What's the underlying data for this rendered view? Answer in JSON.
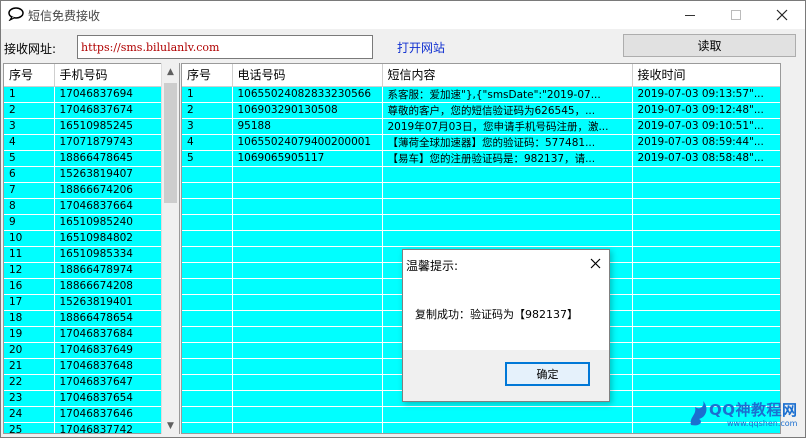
{
  "window": {
    "title": "短信免费接收"
  },
  "toolbar": {
    "url_label": "接收网址:",
    "url_value": "https://sms.bilulanlv.com",
    "open_link": "打开网站",
    "read_button": "读取"
  },
  "numbers": {
    "headers": [
      "序号",
      "手机号码"
    ],
    "rows": [
      [
        "1",
        "17046837694"
      ],
      [
        "2",
        "17046837674"
      ],
      [
        "3",
        "16510985245"
      ],
      [
        "4",
        "17071879743"
      ],
      [
        "5",
        "18866478645"
      ],
      [
        "6",
        "15263819407"
      ],
      [
        "7",
        "18866674206"
      ],
      [
        "8",
        "17046837664"
      ],
      [
        "9",
        "16510985240"
      ],
      [
        "10",
        "16510984802"
      ],
      [
        "11",
        "16510985334"
      ],
      [
        "12",
        "18866478974"
      ],
      [
        "16",
        "18866674208"
      ],
      [
        "17",
        "15263819401"
      ],
      [
        "18",
        "18866478654"
      ],
      [
        "19",
        "17046837684"
      ],
      [
        "20",
        "17046837649"
      ],
      [
        "21",
        "17046837648"
      ],
      [
        "22",
        "17046837647"
      ],
      [
        "23",
        "17046837654"
      ],
      [
        "24",
        "17046837646"
      ],
      [
        "25",
        "17046837742"
      ]
    ]
  },
  "messages": {
    "headers": [
      "序号",
      "电话号码",
      "短信内容",
      "接收时间"
    ],
    "rows": [
      [
        "1",
        "10655024082833230566",
        "系客服：爱加速\"},{\"smsDate\":\"2019-07...",
        "2019-07-03 09:13:57\"..."
      ],
      [
        "2",
        "106903290130508",
        "尊敬的客户，您的短信验证码为626545，...",
        "2019-07-03 09:12:48\"..."
      ],
      [
        "3",
        "95188",
        "2019年07月03日，您申请手机号码注册，激...",
        "2019-07-03 09:10:51\"..."
      ],
      [
        "4",
        "10655024079400200001",
        "【薄荷全球加速器】您的验证码：577481...",
        "2019-07-03 08:59:44\"..."
      ],
      [
        "5",
        "1069065905117",
        "【易车】您的注册验证码是：982137，请...",
        "2019-07-03 08:58:48\"..."
      ]
    ],
    "blank_rows": 17
  },
  "dialog": {
    "title": "温馨提示:",
    "message": "复制成功：验证码为【982137】",
    "ok_button": "确定"
  },
  "watermark": {
    "text": "QQ神教程网",
    "sub": "www.qqshen.com"
  },
  "icons": {
    "app": "speech-bubble-icon",
    "close": "close-icon"
  },
  "colors": {
    "table_bg": "#00ffff",
    "link": "#1030d0",
    "url_text": "#b00000",
    "dialog_focus": "#0078d7"
  }
}
